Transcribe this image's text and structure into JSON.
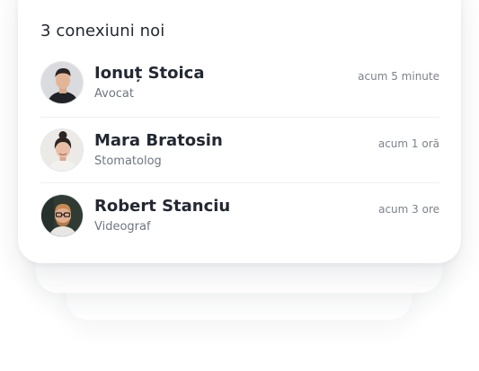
{
  "card": {
    "title": "3 conexiuni noi"
  },
  "connections": [
    {
      "name": "Ionuț Stoica",
      "role": "Avocat",
      "time": "acum 5 minute",
      "avatar_icon": "person-photo-icon"
    },
    {
      "name": "Mara Bratosin",
      "role": "Stomatolog",
      "time": "acum 1 oră",
      "avatar_icon": "person-photo-icon"
    },
    {
      "name": "Robert Stanciu",
      "role": "Videograf",
      "time": "acum 3 ore",
      "avatar_icon": "person-photo-icon"
    }
  ],
  "colors": {
    "text_primary": "#232833",
    "text_secondary": "#6f7682",
    "divider": "#eef0f3",
    "card_background": "#ffffff"
  }
}
